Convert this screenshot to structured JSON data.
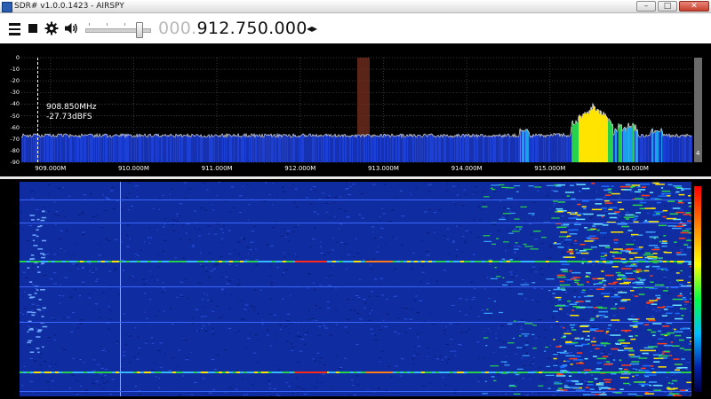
{
  "window": {
    "title": "SDR# v1.0.0.1423 - AIRSPY",
    "buttons": {
      "minimize": "–",
      "maximize": "□",
      "close": "✕"
    }
  },
  "toolbar": {
    "frequency_dim": "000.",
    "frequency_main": "912.750.000",
    "icons": [
      "menu-icon",
      "stop-icon",
      "gear-icon",
      "speaker-icon",
      "arrows-icon"
    ]
  },
  "spectrum": {
    "y_ticks": [
      "0",
      "-10",
      "-20",
      "-30",
      "-40",
      "-50",
      "-60",
      "-70",
      "-80",
      "-90"
    ],
    "x_ticks": [
      "909.000M",
      "910.000M",
      "911.000M",
      "912.000M",
      "913.000M",
      "914.000M",
      "915.000M",
      "916.000M"
    ],
    "readout_freq": "908.850MHz",
    "readout_level": "-27.73dBFS",
    "scroll_value": "4"
  },
  "colors": {
    "spectrum_fill": "#1c3fd6",
    "waterfall_bg": "#0f2da0",
    "trace": "#c8c8c8"
  }
}
